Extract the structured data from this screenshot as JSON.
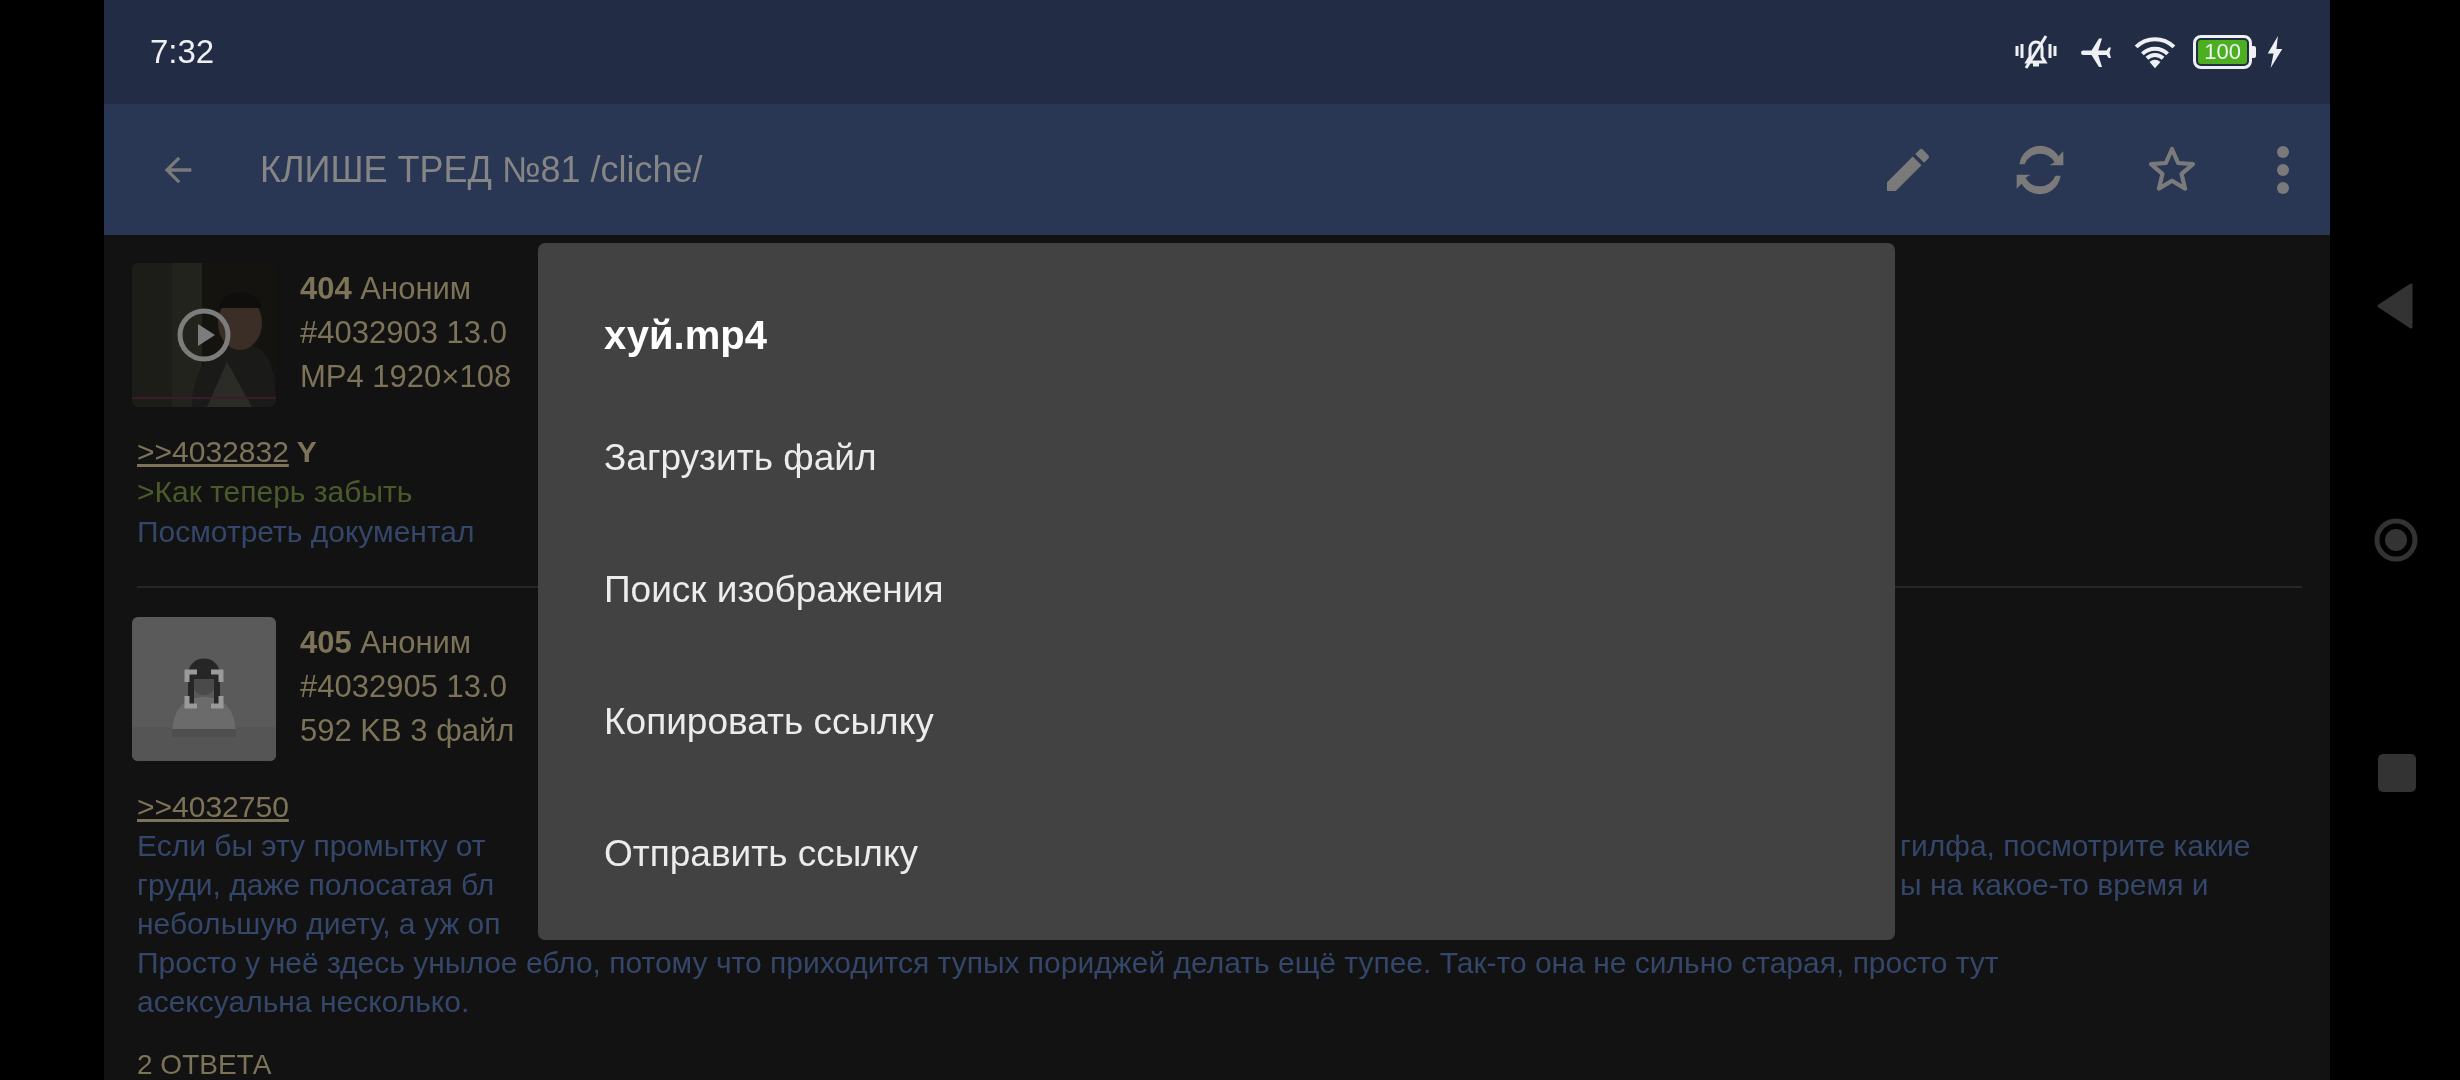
{
  "status_bar": {
    "time": "7:32",
    "battery": "100"
  },
  "toolbar": {
    "title": "КЛИШЕ ТРЕД №81 /cliche/"
  },
  "posts": [
    {
      "number": "404",
      "author": "Аноним",
      "meta": [
        "#4032903 13.0",
        "MP4 1920×108"
      ],
      "thumbnail": {
        "kind": "video"
      },
      "lines": [
        {
          "kind": "reply",
          "link": ">>4032832",
          "suffix": "Y"
        },
        {
          "kind": "quote",
          "left": ">Как теперь забыть"
        },
        {
          "kind": "text",
          "left": "Посмотреть документал"
        }
      ]
    },
    {
      "number": "405",
      "author": "Аноним",
      "meta": [
        "#4032905 13.0",
        "592 KB 3 файл"
      ],
      "thumbnail": {
        "kind": "gallery"
      },
      "lines": [
        {
          "kind": "reply",
          "link": ">>4032750"
        },
        {
          "kind": "text",
          "left": "Если бы эту промытку от",
          "right": "гилфа, посмотрите какие"
        },
        {
          "kind": "text",
          "left": "груди, даже полосатая бл",
          "right": "ы на какое-то время и"
        },
        {
          "kind": "text",
          "left": "небольшую диету, а уж оп"
        },
        {
          "kind": "text",
          "left": "Просто у неё здесь унылое ебло, потому что приходится тупых пориджей делать ещё тупее. Так-то она не сильно старая, просто тут"
        },
        {
          "kind": "text",
          "left": "асексуальна несколько."
        }
      ],
      "replies": "2 ОТВЕТА"
    }
  ],
  "dialog": {
    "title": "хуй.mp4",
    "items": [
      "Загрузить файл",
      "Поиск изображения",
      "Копировать ссылку",
      "Отправить ссылку"
    ]
  }
}
